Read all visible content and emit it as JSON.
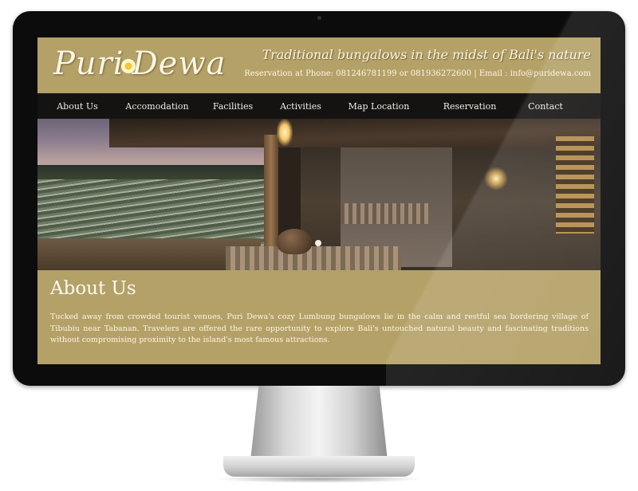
{
  "site": {
    "logo_text": "Puri Dewa",
    "tagline": "Traditional bungalows in the midst of Bali's nature",
    "contact_line": "Reservation at Phone: 081246781199 or 081936272600 | Email : info@puridewa.com"
  },
  "nav": {
    "items": [
      {
        "label": "About Us"
      },
      {
        "label": "Accomodation"
      },
      {
        "label": "Facilities"
      },
      {
        "label": "Activities"
      },
      {
        "label": "Map Location"
      },
      {
        "label": "Reservation"
      },
      {
        "label": "Contact"
      }
    ]
  },
  "about": {
    "title": "About Us",
    "body": "Tucked away from crowded tourist venues, Puri Dewa's cozy Lumbung bungalows lie in the calm and restful sea bordering village of Tibubiu near Tabanan. Travelers are offered the rare opportunity to explore Bali's untouched natural beauty and fascinating traditions without compromising proximity to the island's most famous attractions."
  },
  "colors": {
    "header_bg": "#b4a167",
    "nav_bg": "#151311",
    "text_light": "#fbf6e6",
    "monitor_bezel": "#0c0c0c"
  },
  "icons": {
    "logo_flower": "frangipani-flower-icon"
  }
}
